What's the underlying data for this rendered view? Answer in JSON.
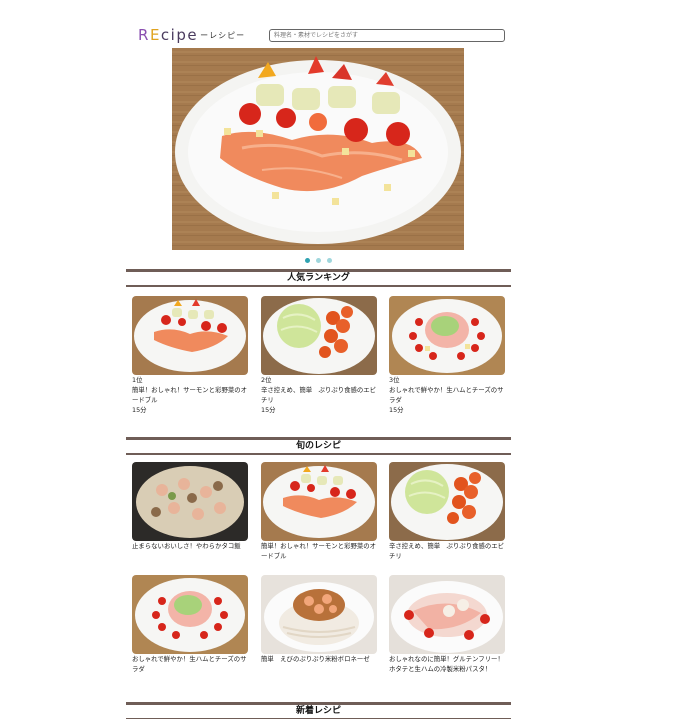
{
  "header": {
    "logo": {
      "part1": "R",
      "part2": "E",
      "part3": "cipe",
      "sub": "ーレシピー"
    },
    "search_placeholder": "料理名・素材でレシピをさがす"
  },
  "colors": {
    "accent_dot": "#2fa2b1",
    "section_bar": "#6f5d57"
  },
  "hero": {
    "carousel_dots": 3,
    "active_dot": 1
  },
  "sections": {
    "ranking": {
      "title": "人気ランキング",
      "items": [
        {
          "rank": "1位",
          "name": "簡単！おしゃれ！サーモンと彩野菜のオードブル",
          "time": "15分",
          "image": "salmon-platter"
        },
        {
          "rank": "2位",
          "name": "辛さ控えめ、簡単　ぷりぷり食感のエビチリ",
          "time": "15分",
          "image": "ebichili"
        },
        {
          "rank": "3位",
          "name": "おしゃれで鮮やか！生ハムとチーズのサラダ",
          "time": "15分",
          "image": "ham-salad"
        }
      ]
    },
    "seasonal": {
      "title": "旬のレシピ",
      "items": [
        {
          "name": "止まらないおいしさ！やわらかタコ飯",
          "image": "tako-rice"
        },
        {
          "name": "簡単！おしゃれ！サーモンと彩野菜のオードブル",
          "image": "salmon-platter"
        },
        {
          "name": "辛さ控えめ、簡単　ぷりぷり食感のエビチリ",
          "image": "ebichili"
        },
        {
          "name": "おしゃれで鮮やか！生ハムとチーズのサラダ",
          "image": "ham-salad"
        },
        {
          "name": "簡単　えびのぷりぷり米粉ボロネーゼ",
          "image": "shrimp-bolognese"
        },
        {
          "name": "おしゃれなのに簡単！グルテンフリー！ホタテと生ハムの冷製米粉パスタ！",
          "image": "scallop-pasta"
        }
      ]
    },
    "new": {
      "title": "新着レシピ"
    }
  }
}
